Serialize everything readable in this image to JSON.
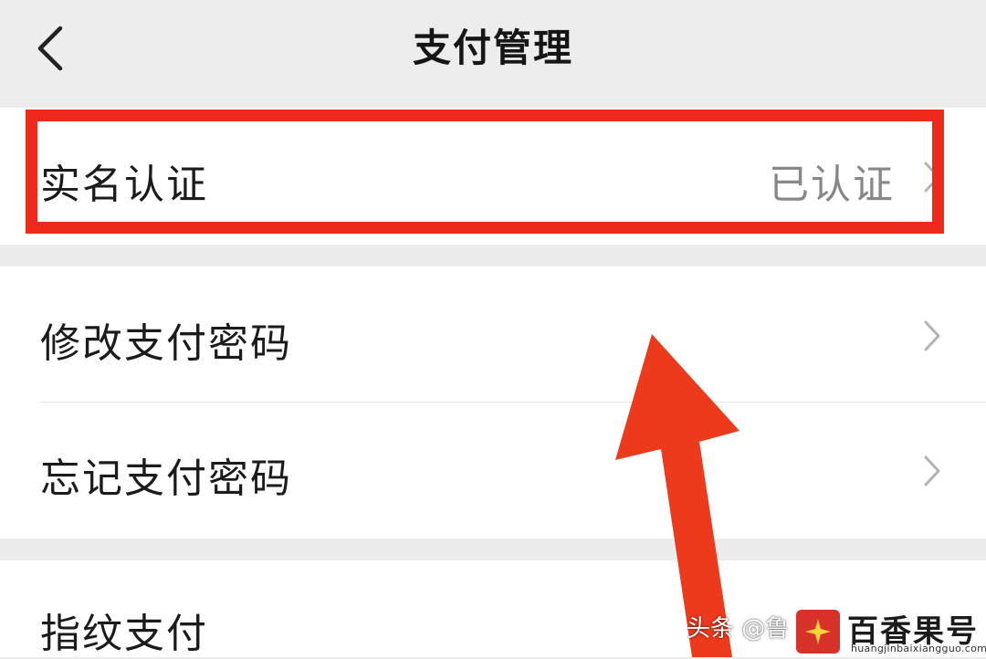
{
  "header": {
    "title": "支付管理",
    "back_icon": "chevron-left-icon"
  },
  "verification": {
    "label": "实名认证",
    "value": "已认证",
    "chevron_icon": "chevron-right-icon"
  },
  "password_group": {
    "items": [
      {
        "label": "修改支付密码",
        "chevron_icon": "chevron-right-icon"
      },
      {
        "label": "忘记支付密码",
        "chevron_icon": "chevron-right-icon"
      }
    ]
  },
  "fingerprint": {
    "label": "指纹支付"
  },
  "annotations": {
    "highlight_color": "#ee2a1a",
    "arrow_color": "#ee3a1c"
  },
  "watermark": {
    "prefix": "头条 @鲁",
    "brand": "百香果号",
    "url": "huangjinbaixiangguo.com"
  }
}
